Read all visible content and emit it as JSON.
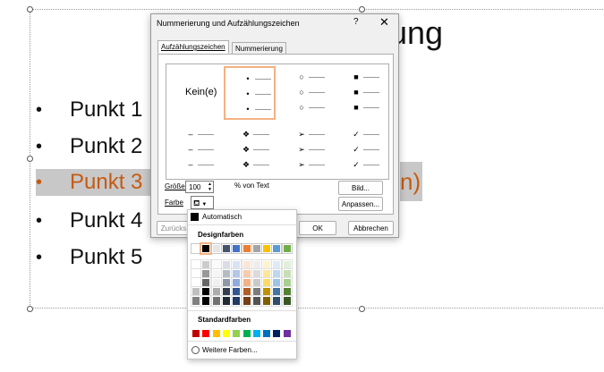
{
  "slide": {
    "title_fragment": "ung",
    "bullets": [
      "Punkt 1",
      "Punkt 2",
      "Punkt 3",
      "Punkt 4",
      "Punkt 5"
    ],
    "bullet_glyph": "•",
    "hidden_tail": "n)",
    "selected_index": 2,
    "highlight_color": "#c55a11"
  },
  "dialog": {
    "title": "Nummerierung und Aufzählungszeichen",
    "help": "?",
    "close": "✕",
    "tabs": [
      "Aufzählungszeichen",
      "Nummerierung"
    ],
    "none_label": "Kein(e)",
    "gallery": [
      [
        "•",
        "○",
        "■"
      ],
      [
        "–",
        "❖",
        "➢",
        "✓"
      ]
    ],
    "size_label": "Größe:",
    "size_value": "100",
    "size_unit": "% von Text",
    "color_label": "Farbe",
    "buttons": {
      "picture": "Bild...",
      "customize": "Anpassen...",
      "reset": "Zurücks",
      "ok": "OK",
      "cancel": "Abbrechen"
    }
  },
  "color_popup": {
    "automatic": "Automatisch",
    "theme_colors_title": "Designfarben",
    "standard_colors_title": "Standardfarben",
    "more_colors": "Weitere Farben...",
    "theme_top": [
      "#ffffff",
      "#000000",
      "#e7e6e6",
      "#44546a",
      "#4472c4",
      "#ed7d31",
      "#a5a5a5",
      "#ffc000",
      "#5b9bd5",
      "#70ad47"
    ],
    "standard": [
      "#c00000",
      "#ff0000",
      "#ffc000",
      "#ffff00",
      "#92d050",
      "#00b050",
      "#00b0f0",
      "#0070c0",
      "#002060",
      "#7030a0"
    ]
  }
}
